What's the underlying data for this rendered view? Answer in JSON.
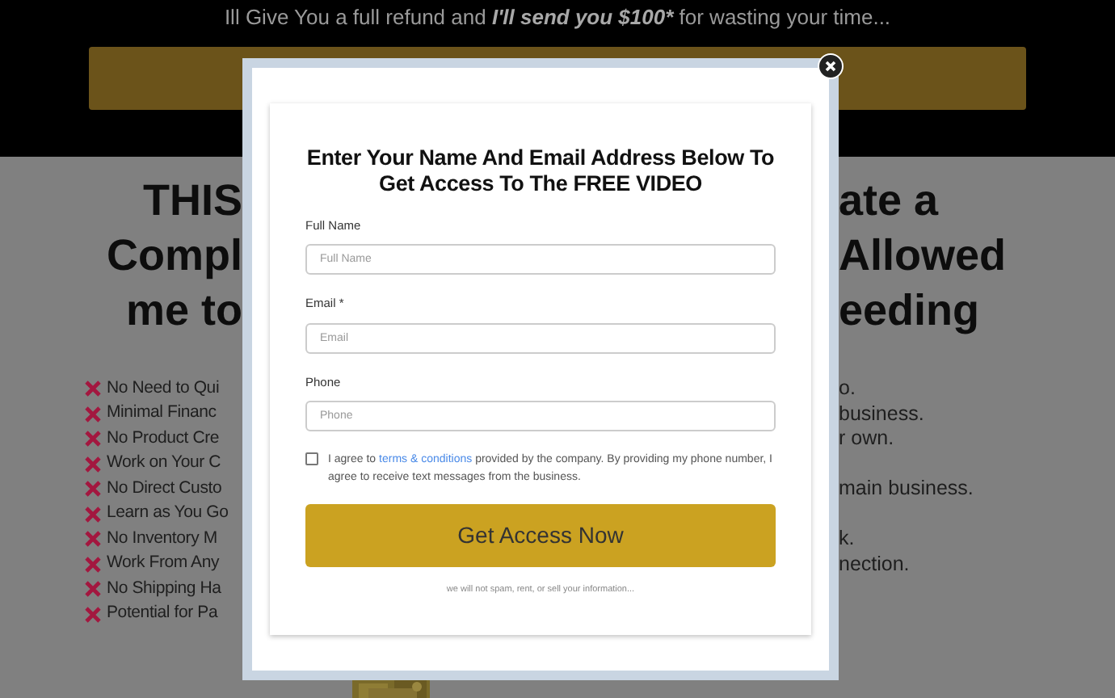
{
  "banner": {
    "before": "Ill Give You a full refund and ",
    "emphasis": "I'll send you $100*",
    "after": " for wasting your time..."
  },
  "headline": [
    {
      "left": "THIS",
      "right": "ate a"
    },
    {
      "left": "Compl",
      "right": "Allowed"
    },
    {
      "left": "me to",
      "right": "eeding"
    }
  ],
  "bullets": [
    {
      "left": "No Need to Qui",
      "right": "o."
    },
    {
      "left": "Minimal Financ",
      "right": "business."
    },
    {
      "left": "No Product Cre",
      "right": "r own."
    },
    {
      "left": "Work on Your C"
    },
    {
      "left": "No Direct Custo",
      "right": "main business."
    },
    {
      "left": "Learn as You Go"
    },
    {
      "left": "No Inventory M",
      "right": "k."
    },
    {
      "left": "Work From Any",
      "right": "nection."
    },
    {
      "left": "No Shipping Ha"
    },
    {
      "left": "Potential for Pa"
    }
  ],
  "modal": {
    "title": "Enter Your Name And Email Address Below To Get Access To The FREE VIDEO",
    "fields": [
      {
        "label": "Full Name",
        "placeholder": "Full Name"
      },
      {
        "label": "Email *",
        "placeholder": "Email"
      },
      {
        "label": "Phone",
        "placeholder": "Phone"
      }
    ],
    "consent": {
      "checked": false,
      "before": "I agree to ",
      "link": "terms & conditions",
      "after": " provided by the company. By providing my phone number, I agree to receive text messages from the business."
    },
    "submit": "Get Access Now",
    "footnote": "we will not spam, rent, or sell your information..."
  }
}
